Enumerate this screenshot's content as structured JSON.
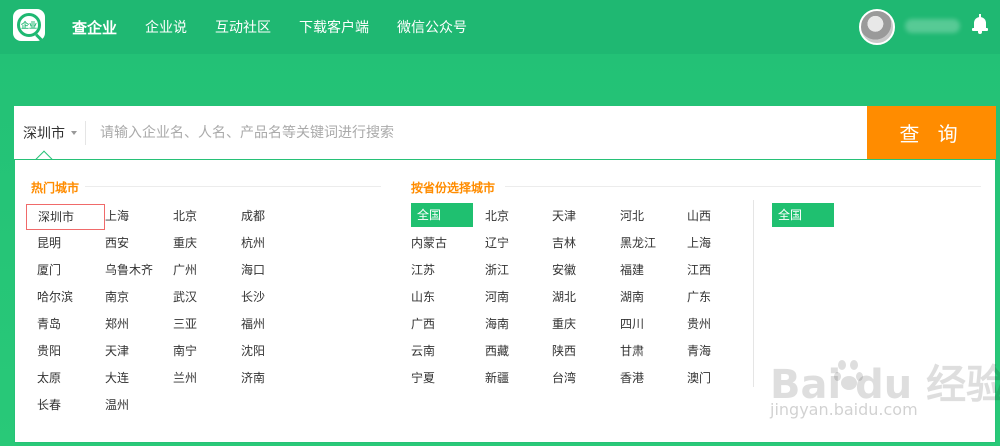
{
  "nav": {
    "logo_text": "企业",
    "items": [
      {
        "label": "查企业",
        "active": true
      },
      {
        "label": "企业说"
      },
      {
        "label": "互动社区"
      },
      {
        "label": "下载客户端"
      },
      {
        "label": "微信公众号"
      }
    ]
  },
  "search": {
    "city": "深圳市",
    "placeholder": "请输入企业名、人名、产品名等关键词进行搜索",
    "button_label": "查 询"
  },
  "hot_cities": {
    "title": "热门城市",
    "selected": "深圳市",
    "rows": [
      [
        "深圳市",
        "上海",
        "北京",
        "成都"
      ],
      [
        "昆明",
        "西安",
        "重庆",
        "杭州"
      ],
      [
        "厦门",
        "乌鲁木齐",
        "广州",
        "海口"
      ],
      [
        "哈尔滨",
        "南京",
        "武汉",
        "长沙"
      ],
      [
        "青岛",
        "郑州",
        "三亚",
        "福州"
      ],
      [
        "贵阳",
        "天津",
        "南宁",
        "沈阳"
      ],
      [
        "太原",
        "大连",
        "兰州",
        "济南"
      ],
      [
        "长春",
        "温州"
      ]
    ]
  },
  "provinces": {
    "title": "按省份选择城市",
    "rows": [
      [
        "全国",
        "北京",
        "天津",
        "河北",
        "山西"
      ],
      [
        "内蒙古",
        "辽宁",
        "吉林",
        "黑龙江",
        "上海"
      ],
      [
        "江苏",
        "浙江",
        "安徽",
        "福建",
        "江西"
      ],
      [
        "山东",
        "河南",
        "湖北",
        "湖南",
        "广东"
      ],
      [
        "广西",
        "海南",
        "重庆",
        "四川",
        "贵州"
      ],
      [
        "云南",
        "西藏",
        "陕西",
        "甘肃",
        "青海"
      ],
      [
        "宁夏",
        "新疆",
        "台湾",
        "香港",
        "澳门"
      ]
    ],
    "side_selected": "全国"
  },
  "watermark": {
    "text": "Bai  du 经验",
    "url": "jingyan.baidu.com"
  },
  "colors": {
    "brand_green": "#1fb872",
    "search_button": "#ff8c00",
    "section_title": "#ff8c00"
  }
}
